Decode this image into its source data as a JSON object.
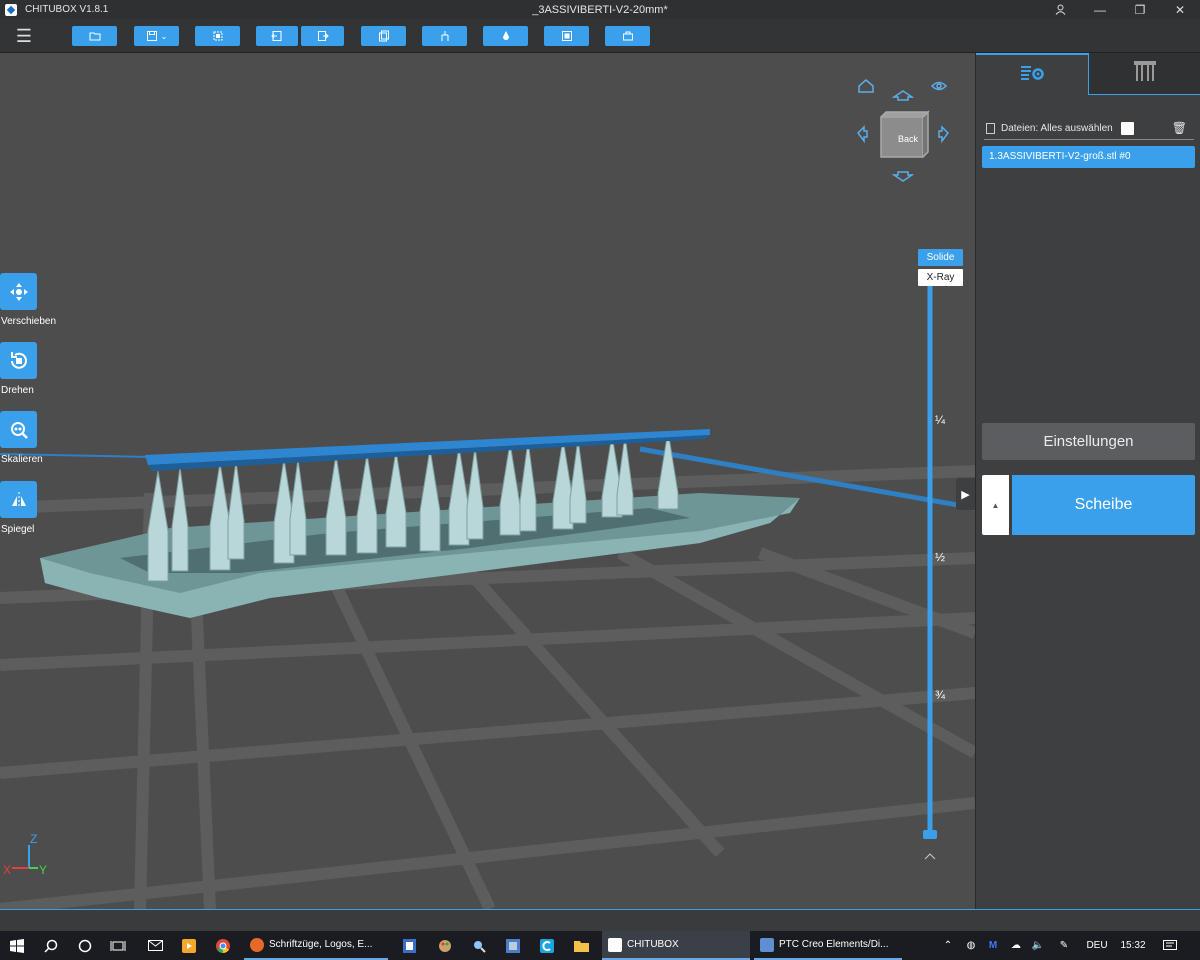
{
  "window": {
    "app_name": "CHITUBOX V1.8.1",
    "document_title": "_3ASSIVIBERTI-V2-20mm*"
  },
  "colors": {
    "accent": "#3aa0ec",
    "model": "#7fa9aa",
    "support": "#b9d6d8",
    "panel": "#3e3f41"
  },
  "toolbar": {
    "menu_icon": "hamburger-icon",
    "buttons": [
      "open-file-icon",
      "save-icon",
      "auto-layout-icon",
      "import-icon",
      "export-icon",
      "copy-icon",
      "supports-icon",
      "hollow-icon",
      "dig-hole-icon",
      "measure-icon"
    ]
  },
  "left_tools": [
    {
      "label": "Verschieben",
      "icon": "move-icon"
    },
    {
      "label": "Drehen",
      "icon": "rotate-icon"
    },
    {
      "label": "Skalieren",
      "icon": "scale-icon"
    },
    {
      "label": "Spiegel",
      "icon": "mirror-icon"
    }
  ],
  "view_cube": {
    "face_label": "Back"
  },
  "view_modes": {
    "solid": "Solide",
    "xray": "X-Ray"
  },
  "layer_slider": {
    "marks": [
      "¼",
      "½",
      "¾"
    ],
    "value": 1.0
  },
  "axes": {
    "z": "Z",
    "x": "X",
    "y": "Y"
  },
  "right_panel": {
    "files_label": "Dateien: Alles auswählen",
    "files": [
      "1.3ASSIVIBERTI-V2-groß.stl #0"
    ],
    "settings_label": "Einstellungen",
    "slice_label": "Scheibe"
  },
  "taskbar": {
    "apps": [
      "Schriftzüge, Logos, E...",
      "CHITUBOX",
      "PTC Creo Elements/Di..."
    ],
    "language": "DEU",
    "time": "15:32"
  }
}
